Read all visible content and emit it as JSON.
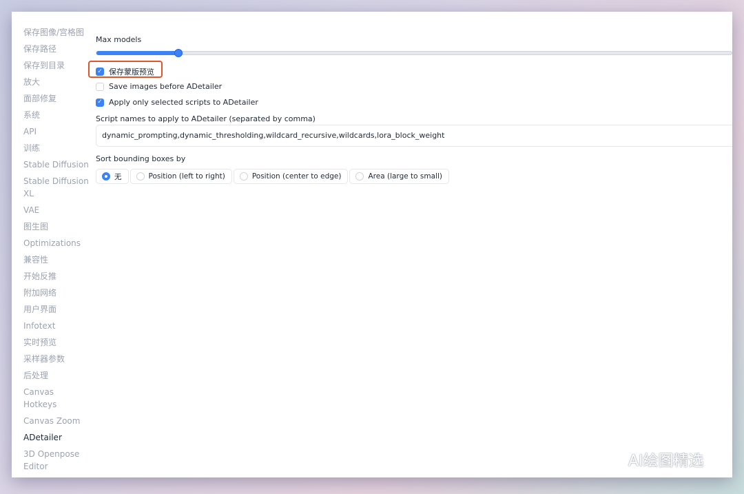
{
  "sidebar": {
    "items": [
      {
        "label": "保存图像/宫格图"
      },
      {
        "label": "保存路径"
      },
      {
        "label": "保存到目录"
      },
      {
        "label": "放大"
      },
      {
        "label": "面部修复"
      },
      {
        "label": "系统"
      },
      {
        "label": "API"
      },
      {
        "label": "训练"
      },
      {
        "label": "Stable Diffusion"
      },
      {
        "label": "Stable Diffusion XL"
      },
      {
        "label": "VAE"
      },
      {
        "label": "图生图"
      },
      {
        "label": "Optimizations"
      },
      {
        "label": "兼容性"
      },
      {
        "label": "开始反推"
      },
      {
        "label": "附加网络"
      },
      {
        "label": "用户界面"
      },
      {
        "label": "Infotext"
      },
      {
        "label": "实时预览"
      },
      {
        "label": "采样器参数"
      },
      {
        "label": "后处理"
      },
      {
        "label": "Canvas Hotkeys"
      },
      {
        "label": "Canvas Zoom"
      },
      {
        "label": "ADetailer",
        "active": true
      },
      {
        "label": "3D Openpose Editor"
      }
    ]
  },
  "settings": {
    "max_models_label": "Max models",
    "max_models_fill_fraction": 0.13,
    "checkbox_save_mask": {
      "label": "保存蒙版预览",
      "checked": true
    },
    "checkbox_save_before": {
      "label": "Save images before ADetailer",
      "checked": false
    },
    "checkbox_apply_selected": {
      "label": "Apply only selected scripts to ADetailer",
      "checked": true
    },
    "script_names_label": "Script names to apply to ADetailer (separated by comma)",
    "script_names_value": "dynamic_prompting,dynamic_thresholding,wildcard_recursive,wildcards,lora_block_weight",
    "sort_label": "Sort bounding boxes by",
    "sort_options": [
      {
        "label": "无",
        "selected": true
      },
      {
        "label": "Position (left to right)",
        "selected": false
      },
      {
        "label": "Position (center to edge)",
        "selected": false
      },
      {
        "label": "Area (large to small)",
        "selected": false
      }
    ]
  },
  "watermark": {
    "text": "AI绘图精选"
  },
  "colors": {
    "accent": "#3b82f6",
    "highlight_border": "#e0552a",
    "sidebar_text": "#9ca3af"
  }
}
